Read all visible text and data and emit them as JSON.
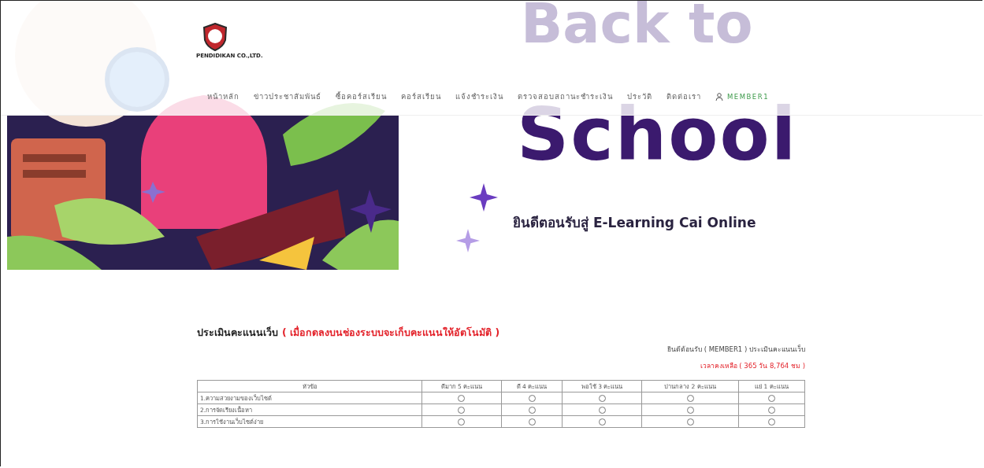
{
  "logo": {
    "company": "PENDIDIKAN CO.,LTD."
  },
  "nav": {
    "items": [
      {
        "label": "หน้าหลัก",
        "kind": "link"
      },
      {
        "label": "ข่าวประชาสัมพันธ์",
        "kind": "link"
      },
      {
        "label": "ซื้อคอร์สเรียน",
        "kind": "link"
      },
      {
        "label": "คอร์สเรียน",
        "kind": "link"
      },
      {
        "label": "แจ้งชำระเงิน",
        "kind": "link"
      },
      {
        "label": "ตรวจสอบสถานะชำระเงิน",
        "kind": "link"
      },
      {
        "label": "ประวัติ",
        "kind": "link"
      },
      {
        "label": "ติดต่อเรา",
        "kind": "link"
      },
      {
        "label": "MEMBER1",
        "kind": "user"
      }
    ]
  },
  "hero": {
    "title_top": "Back to",
    "title_bottom": "School",
    "welcome": "ยินดีตอนรับสู่ E-Learning Cai Online"
  },
  "survey": {
    "title": "ประเมินคะแนนเว็บ",
    "notice": "( เมื่อกดลงบนช่องระบบจะเก็บคะแนนให้อัตโนมัติ )",
    "greeting": "ยินดีต้อนรับ ( MEMBER1 ) ประเมินคะแนนเว็บ",
    "time_left": "เวลาคงเหลือ ( 365 วัน 8,764 ชม )",
    "table": {
      "columns": [
        "หัวข้อ",
        "ดีมาก 5 คะแนน",
        "ดี 4 คะแนน",
        "พอใช้ 3 คะแนน",
        "ปานกลาง 2 คะแนน",
        "แย่ 1 คะแนน"
      ],
      "rows": [
        {
          "topic": "1.ความสวยงามของเว็บไซต์",
          "options": [
            {
              "selected": false
            },
            {
              "selected": false
            },
            {
              "selected": false
            },
            {
              "selected": false
            },
            {
              "selected": false
            }
          ]
        },
        {
          "topic": "2.การจัดเรียงเนื้อหา",
          "options": [
            {
              "selected": false
            },
            {
              "selected": false
            },
            {
              "selected": false
            },
            {
              "selected": false
            },
            {
              "selected": false
            }
          ]
        },
        {
          "topic": "3.การใช้งานเว็บไซต์ง่าย",
          "options": [
            {
              "selected": false
            },
            {
              "selected": false
            },
            {
              "selected": false
            },
            {
              "selected": false
            },
            {
              "selected": false
            }
          ]
        }
      ]
    }
  }
}
